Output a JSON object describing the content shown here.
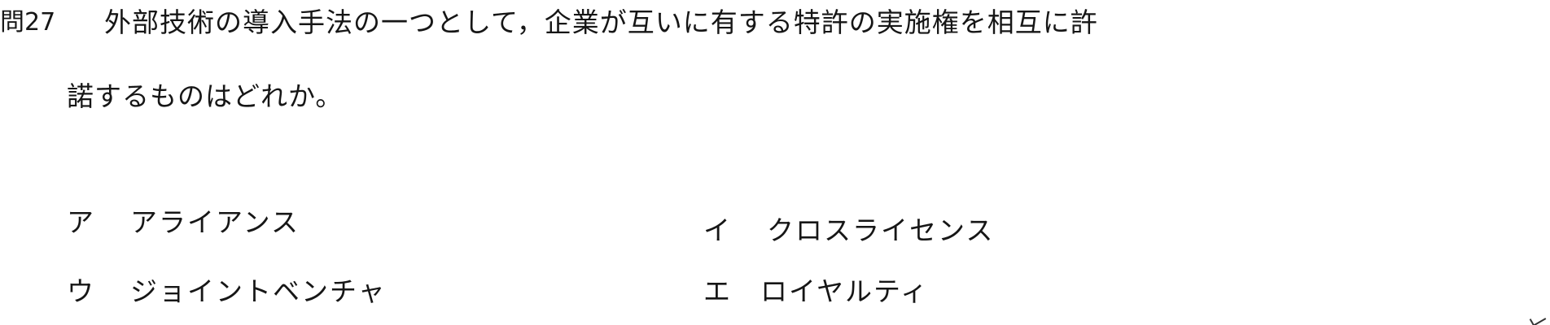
{
  "question": {
    "number": "問27",
    "stem_line1": "外部技術の導入手法の一つとして，企業が互いに有する特許の実施権を相互に許",
    "stem_line2": "諾するものはどれか。"
  },
  "choices": [
    {
      "mark": "ア",
      "text": "アライアンス"
    },
    {
      "mark": "イ",
      "text": "クロスライセンス"
    },
    {
      "mark": "ウ",
      "text": "ジョイントベンチャ"
    },
    {
      "mark": "エ",
      "text": "ロイヤルティ"
    }
  ]
}
